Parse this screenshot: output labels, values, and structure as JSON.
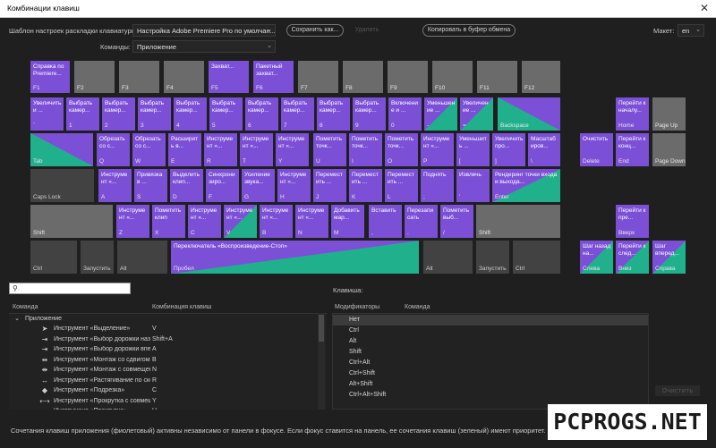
{
  "window": {
    "title": "Комбинации клавиш"
  },
  "toolbar": {
    "preset_label": "Шаблон настроек раскладки клавиатуры:",
    "preset_value": "Настройка Adobe Premiere Pro по умолчан...",
    "save_as": "Сохранить как...",
    "delete": "Удалить",
    "copy": "Копировать в буфер обмена",
    "commands_label": "Команды:",
    "commands_value": "Приложение",
    "layout_label": "Макет:",
    "layout_value": "en"
  },
  "keys": [
    {
      "label": "F1",
      "cmd": "Справка по Premiere...",
      "style": "app"
    },
    {
      "label": "F2",
      "cmd": "",
      "style": ""
    },
    {
      "label": "F3",
      "cmd": "",
      "style": ""
    },
    {
      "label": "F4",
      "cmd": "",
      "style": ""
    },
    {
      "label": "F5",
      "cmd": "Захват...",
      "style": "app"
    },
    {
      "label": "F6",
      "cmd": "Пакетный захват...",
      "style": "app"
    },
    {
      "label": "F7",
      "cmd": "",
      "style": ""
    },
    {
      "label": "F8",
      "cmd": "",
      "style": ""
    },
    {
      "label": "F9",
      "cmd": "",
      "style": ""
    },
    {
      "label": "F10",
      "cmd": "",
      "style": ""
    },
    {
      "label": "F11",
      "cmd": "",
      "style": ""
    },
    {
      "label": "F12",
      "cmd": "",
      "style": ""
    },
    {
      "label": "`",
      "cmd": "Увеличить и ...",
      "style": "app"
    },
    {
      "label": "1",
      "cmd": "Выбрать камер...",
      "style": "app"
    },
    {
      "label": "2",
      "cmd": "Выбрать камер...",
      "style": "app"
    },
    {
      "label": "3",
      "cmd": "Выбрать камер...",
      "style": "app"
    },
    {
      "label": "4",
      "cmd": "Выбрать камер...",
      "style": "app"
    },
    {
      "label": "5",
      "cmd": "Выбрать камер...",
      "style": "app"
    },
    {
      "label": "6",
      "cmd": "Выбрать камер...",
      "style": "app"
    },
    {
      "label": "7",
      "cmd": "Выбрать камер...",
      "style": "app"
    },
    {
      "label": "8",
      "cmd": "Выбрать камер...",
      "style": "app"
    },
    {
      "label": "9",
      "cmd": "Выбрать камер...",
      "style": "app"
    },
    {
      "label": "0",
      "cmd": "Включение и ...",
      "style": "app"
    },
    {
      "label": "-",
      "cmd": "Уменьшение ...",
      "style": "both"
    },
    {
      "label": "=",
      "cmd": "Увеличение ...",
      "style": "both"
    },
    {
      "label": "Backspace",
      "cmd": "",
      "style": "both-r"
    },
    {
      "label": "Home",
      "cmd": "Перейти к началу...",
      "style": "app"
    },
    {
      "label": "Page Up",
      "cmd": "",
      "style": ""
    },
    {
      "label": "Tab",
      "cmd": "",
      "style": "both-r"
    },
    {
      "label": "Q",
      "cmd": "Обрезать со с...",
      "style": "app"
    },
    {
      "label": "W",
      "cmd": "Обрезать со с...",
      "style": "app"
    },
    {
      "label": "E",
      "cmd": "Расширить в...",
      "style": "app"
    },
    {
      "label": "R",
      "cmd": "Инструмент «...",
      "style": "app"
    },
    {
      "label": "T",
      "cmd": "Инструмент «...",
      "style": "app"
    },
    {
      "label": "Y",
      "cmd": "Инструмент «...",
      "style": "app"
    },
    {
      "label": "U",
      "cmd": "Пометить точк...",
      "style": "app"
    },
    {
      "label": "I",
      "cmd": "Пометить точк...",
      "style": "app"
    },
    {
      "label": "O",
      "cmd": "Пометить точк...",
      "style": "app"
    },
    {
      "label": "P",
      "cmd": "Инструмент «...",
      "style": "app"
    },
    {
      "label": "[",
      "cmd": "Уменьшить ...",
      "style": "app"
    },
    {
      "label": "]",
      "cmd": "Увеличить про...",
      "style": "app"
    },
    {
      "label": "\\",
      "cmd": "Масштабиров...",
      "style": "app"
    },
    {
      "label": "Delete",
      "cmd": "Очистить",
      "style": "app"
    },
    {
      "label": "End",
      "cmd": "Перейти к конц...",
      "style": "app"
    },
    {
      "label": "Page Down",
      "cmd": "",
      "style": ""
    },
    {
      "label": "Caps Lock",
      "cmd": "",
      "style": "dark"
    },
    {
      "label": "A",
      "cmd": "Инструмент «...",
      "style": "app"
    },
    {
      "label": "S",
      "cmd": "Привязка в ...",
      "style": "app"
    },
    {
      "label": "D",
      "cmd": "Выделить клип...",
      "style": "app"
    },
    {
      "label": "F",
      "cmd": "Синхронизиро...",
      "style": "app"
    },
    {
      "label": "G",
      "cmd": "Усиление звука...",
      "style": "app"
    },
    {
      "label": "H",
      "cmd": "Инструмент «...",
      "style": "app"
    },
    {
      "label": "J",
      "cmd": "Переместить ...",
      "style": "app"
    },
    {
      "label": "K",
      "cmd": "Переместить ...",
      "style": "app"
    },
    {
      "label": "L",
      "cmd": "Переместить ...",
      "style": "app"
    },
    {
      "label": ";",
      "cmd": "Поднять",
      "style": "app"
    },
    {
      "label": "'",
      "cmd": "Извлечь",
      "style": "app"
    },
    {
      "label": "Enter",
      "cmd": "Рендеринг точки входа и выхода...",
      "style": "both"
    },
    {
      "label": "Shift",
      "cmd": "",
      "style": ""
    },
    {
      "label": "Z",
      "cmd": "Инструмент «...",
      "style": "app"
    },
    {
      "label": "X",
      "cmd": "Пометить клип",
      "style": "app"
    },
    {
      "label": "C",
      "cmd": "Инструмент «...",
      "style": "app"
    },
    {
      "label": "V",
      "cmd": "Инструмент «...",
      "style": "both"
    },
    {
      "label": "B",
      "cmd": "Инструмент «...",
      "style": "app"
    },
    {
      "label": "N",
      "cmd": "Инструмент «...",
      "style": "app"
    },
    {
      "label": "M",
      "cmd": "Добавить мар...",
      "style": "app"
    },
    {
      "label": ",",
      "cmd": "Вставить",
      "style": "app"
    },
    {
      "label": ".",
      "cmd": "Перезаписать",
      "style": "app"
    },
    {
      "label": "/",
      "cmd": "Пометить выб...",
      "style": "app"
    },
    {
      "label": "Shift",
      "cmd": "",
      "style": ""
    },
    {
      "label": "Вверх",
      "cmd": "Перейти к пре...",
      "style": "app"
    },
    {
      "label": "Ctrl",
      "cmd": "",
      "style": "dark"
    },
    {
      "label": "Запустить",
      "cmd": "",
      "style": "dark"
    },
    {
      "label": "Alt",
      "cmd": "",
      "style": "dark"
    },
    {
      "label": "Пробел",
      "cmd": "Переключатель «Воспроизведение-Стоп»",
      "style": "both"
    },
    {
      "label": "Alt",
      "cmd": "",
      "style": "dark"
    },
    {
      "label": "Запустить",
      "cmd": "",
      "style": "dark"
    },
    {
      "label": "Ctrl",
      "cmd": "",
      "style": "dark"
    },
    {
      "label": "Слева",
      "cmd": "Шаг назад на...",
      "style": "both"
    },
    {
      "label": "Вниз",
      "cmd": "Перейти к след...",
      "style": "both"
    },
    {
      "label": "Справа",
      "cmd": "Шаг вперед...",
      "style": "both"
    }
  ],
  "list": {
    "col_command": "Команда",
    "col_shortcut": "Комбинация клавиш",
    "group": "Приложение",
    "rows": [
      {
        "icon": "arrow-cursor-icon",
        "name": "Инструмент «Выделение»",
        "key": "V"
      },
      {
        "icon": "track-select-icon",
        "name": "Инструмент «Выбор дорожки назад»",
        "key": "Shift+A"
      },
      {
        "icon": "track-select-icon",
        "name": "Инструмент «Выбор дорожки вперед»",
        "key": "A"
      },
      {
        "icon": "ripple-edit-icon",
        "name": "Инструмент «Монтаж со сдвигом»",
        "key": "B"
      },
      {
        "icon": "rolling-edit-icon",
        "name": "Инструмент «Монтаж с совмещением»",
        "key": "N"
      },
      {
        "icon": "rate-stretch-icon",
        "name": "Инструмент «Растягивание по скорости»",
        "key": "R"
      },
      {
        "icon": "razor-icon",
        "name": "Инструмент «Подрезка»",
        "key": "C"
      },
      {
        "icon": "slip-icon",
        "name": "Инструмент «Прокрутка с совмещением»",
        "key": "Y"
      },
      {
        "icon": "slide-icon",
        "name": "Инструмент «Прокрутка»",
        "key": "U"
      }
    ]
  },
  "modifiers": {
    "keys_label": "Клавиша:",
    "col_modifiers": "Модификаторы",
    "col_command": "Команда",
    "rows": [
      "Нет",
      "Ctrl",
      "Alt",
      "Shift",
      "Ctrl+Alt",
      "Ctrl+Shift",
      "Alt+Shift",
      "Ctrl+Alt+Shift"
    ]
  },
  "buttons": {
    "clear": "Очистить"
  },
  "footer": {
    "text": "Сочетания клавиш приложения (фиолетовый) активны независимо от панели в фокусе. Если фокус ставится на панель, ее сочетания клавиш (зеленый) имеют приоритет."
  },
  "watermark": "PCPROGS.NET",
  "colors": {
    "app": "#7b4fd6",
    "panel": "#21b08c",
    "key": "#6b6b6b"
  }
}
